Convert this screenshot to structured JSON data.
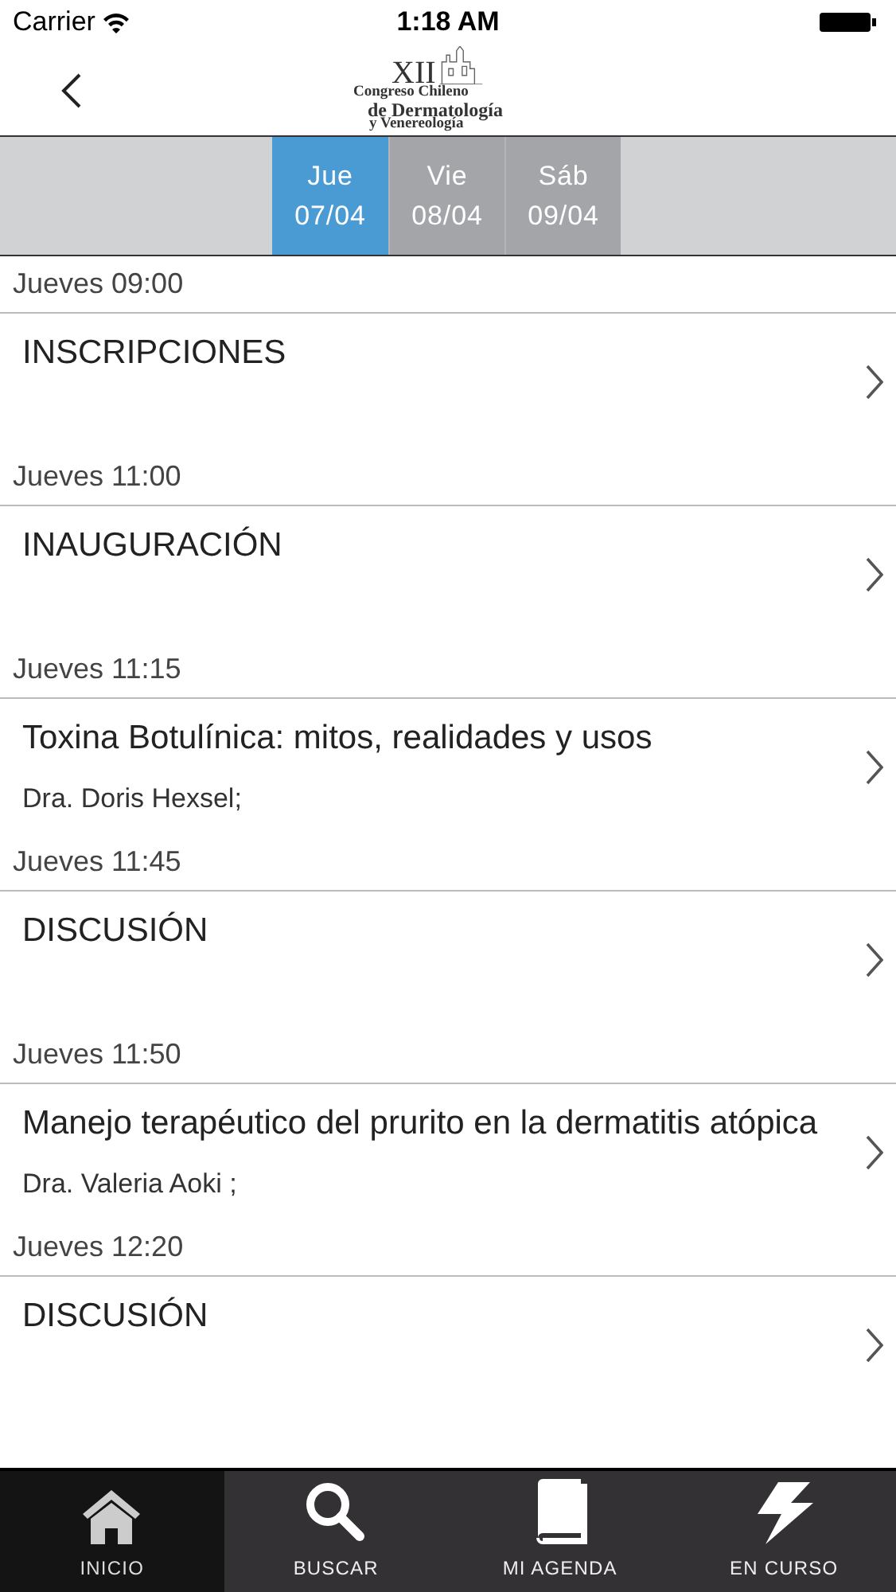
{
  "status_bar": {
    "carrier": "Carrier",
    "time": "1:18 AM"
  },
  "logo": {
    "numeral": "XII",
    "line_1": "Congreso Chileno",
    "line_2": "de Dermatología",
    "line_3": "y Venereología"
  },
  "days": [
    {
      "weekday": "Jue",
      "date": "07/04",
      "selected": true
    },
    {
      "weekday": "Vie",
      "date": "08/04",
      "selected": false
    },
    {
      "weekday": "Sáb",
      "date": "09/04",
      "selected": false
    }
  ],
  "sessions": [
    {
      "time": "Jueves 09:00",
      "title": "INSCRIPCIONES"
    },
    {
      "time": "Jueves 11:00",
      "title": "INAUGURACIÓN"
    },
    {
      "time": "Jueves 11:15",
      "title": "Toxina Botulínica: mitos, realidades y usos",
      "speaker": "Dra. Doris Hexsel;"
    },
    {
      "time": "Jueves 11:45",
      "title": "DISCUSIÓN"
    },
    {
      "time": "Jueves 11:50",
      "title": "Manejo terapéutico del prurito en la dermatitis atópica",
      "speaker": "Dra. Valeria Aoki ;"
    },
    {
      "time": "Jueves 12:20",
      "title": "DISCUSIÓN"
    }
  ],
  "tab_bar": [
    {
      "label": "INICIO",
      "kind": "home",
      "selected": true
    },
    {
      "label": "BUSCAR",
      "kind": "search",
      "selected": false
    },
    {
      "label": "MI AGENDA",
      "kind": "book",
      "selected": false
    },
    {
      "label": "EN CURSO",
      "kind": "bolt",
      "selected": false
    }
  ]
}
